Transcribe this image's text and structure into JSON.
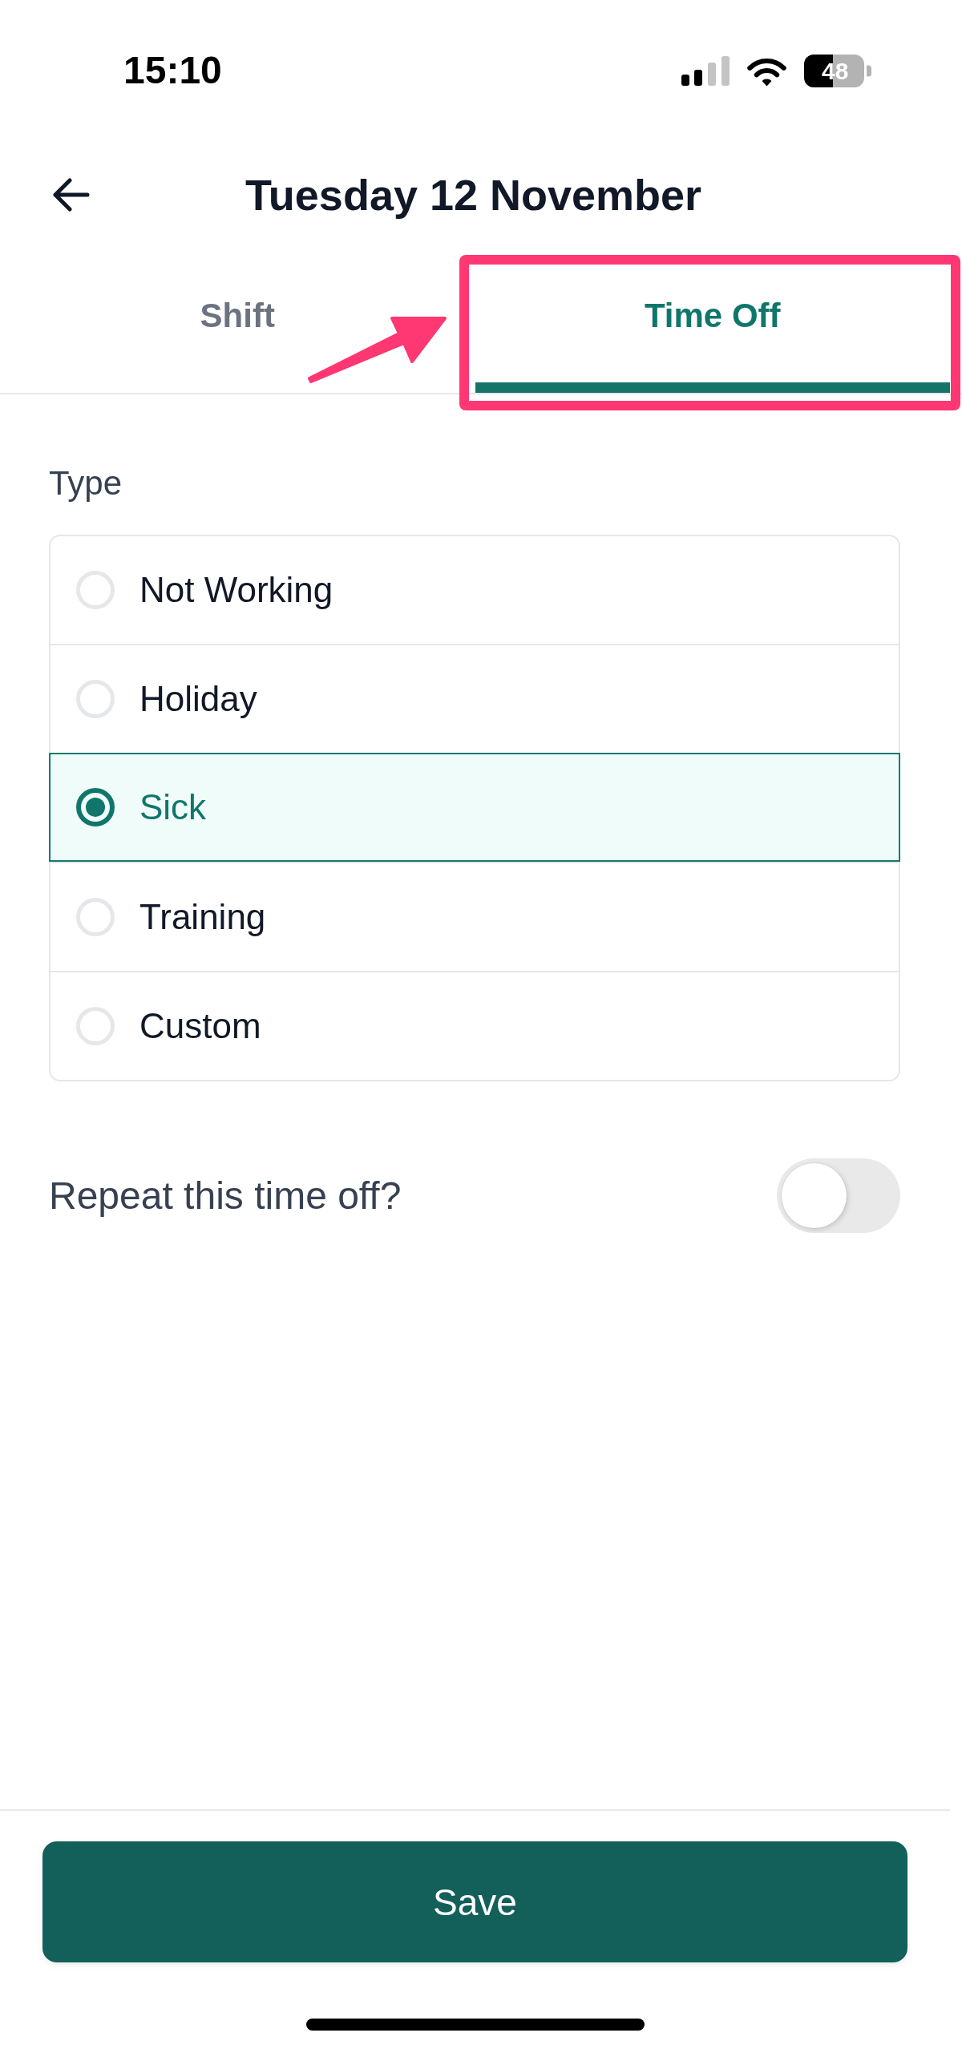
{
  "status_bar": {
    "time": "15:10",
    "battery": "48"
  },
  "header": {
    "title": "Tuesday 12 November"
  },
  "tabs": [
    {
      "label": "Shift",
      "selected": false
    },
    {
      "label": "Time Off",
      "selected": true
    }
  ],
  "annotation": {
    "frame": true,
    "arrow": true
  },
  "type_field": {
    "label": "Type",
    "options": [
      {
        "label": "Not Working",
        "selected": false
      },
      {
        "label": "Holiday",
        "selected": false
      },
      {
        "label": "Sick",
        "selected": true
      },
      {
        "label": "Training",
        "selected": false
      },
      {
        "label": "Custom",
        "selected": false
      }
    ]
  },
  "repeat": {
    "label": "Repeat this time off?",
    "on": false
  },
  "save_button": {
    "label": "Save"
  }
}
